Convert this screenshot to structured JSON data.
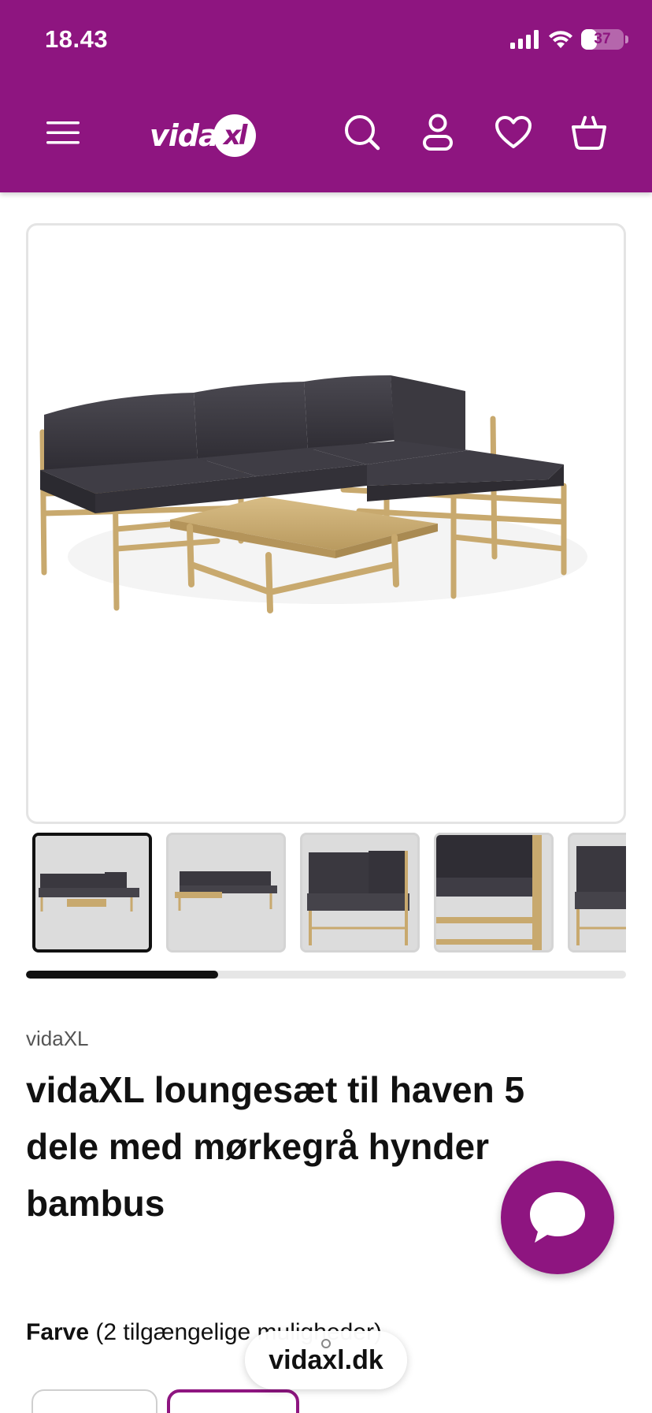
{
  "status_bar": {
    "time": "18.43",
    "battery_level": "37",
    "battery_fraction": 0.37
  },
  "header": {
    "background_color": "#8e1580",
    "logo_text": "vida",
    "logo_mark": "xl",
    "icons": [
      "menu-icon",
      "search-icon",
      "account-icon",
      "heart-icon",
      "basket-icon"
    ]
  },
  "gallery": {
    "thumbnail_count": 5,
    "active_thumbnail": 0,
    "scroll_progress": 0.32
  },
  "product": {
    "brand": "vidaXL",
    "title": "vidaXL loungesæt til haven 5 dele med mørkegrå hynder bambus"
  },
  "color_option": {
    "label": "Farve",
    "count_text": "(2 tilgængelige muligheder)"
  },
  "browser": {
    "url": "vidaxl.dk"
  }
}
